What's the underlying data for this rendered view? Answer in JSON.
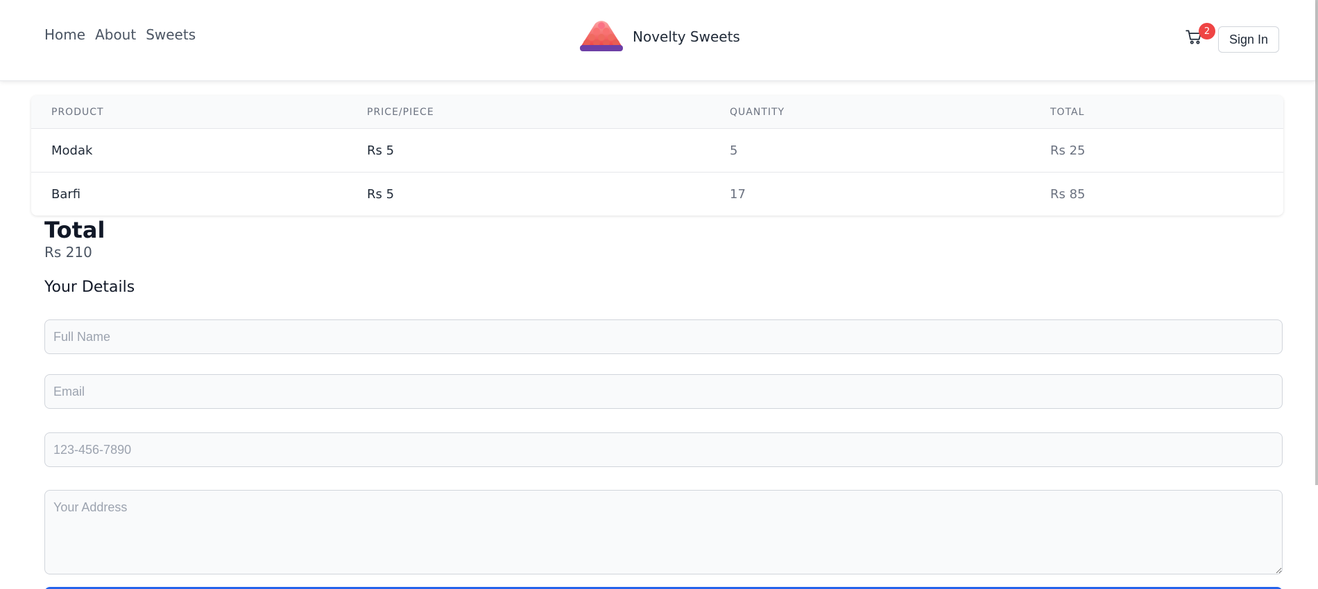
{
  "nav": {
    "links": [
      "Home",
      "About",
      "Sweets"
    ]
  },
  "brand": {
    "name": "Novelty Sweets",
    "logo_icon": "sweets-pyramid-logo"
  },
  "cart": {
    "icon": "cart-icon",
    "count": "2"
  },
  "auth": {
    "signin_label": "Sign In"
  },
  "table": {
    "headers": [
      "PRODUCT",
      "PRICE/PIECE",
      "QUANTITY",
      "TOTAL"
    ],
    "rows": [
      {
        "product": "Modak",
        "price": "Rs 5",
        "quantity": "5",
        "total": "Rs 25"
      },
      {
        "product": "Barfi",
        "price": "Rs 5",
        "quantity": "17",
        "total": "Rs 85"
      }
    ]
  },
  "summary": {
    "total_label": "Total",
    "total_value": "Rs 210"
  },
  "details": {
    "title": "Your Details",
    "name_placeholder": "Full Name",
    "email_placeholder": "Email",
    "phone_placeholder": "123-456-7890",
    "address_placeholder": "Your Address"
  },
  "colors": {
    "accent": "#2563eb",
    "badge": "#ef4444",
    "logo_top": "#f87171",
    "logo_base": "#6d3fa6"
  }
}
